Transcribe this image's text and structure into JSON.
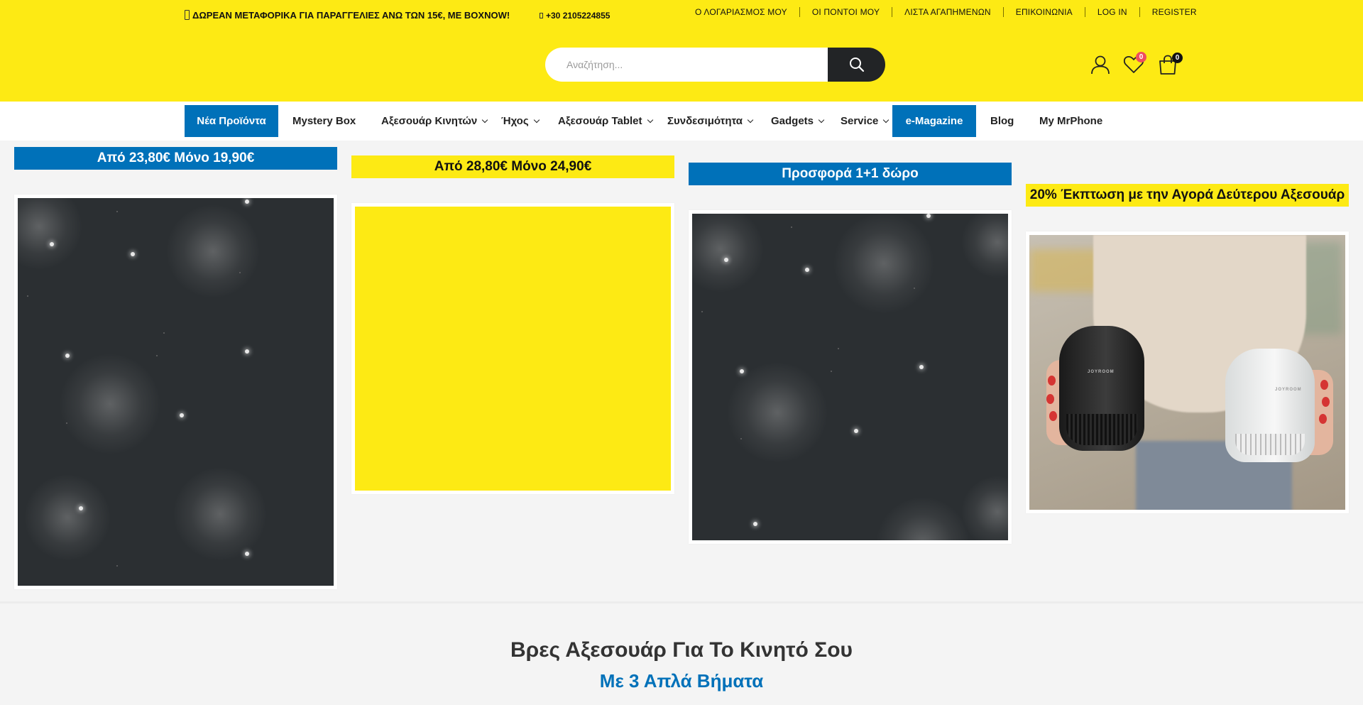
{
  "header": {
    "promo_text": "ΔΩΡΕΑΝ ΜΕΤΑΦΟΡΙΚΑ ΓΙΑ ΠΑΡΑΓΓΕΛΙΕΣ ΑΝΩ ΤΩΝ 15€, ΜΕ BOXNOW!",
    "phone": "+30 2105224855",
    "top_links": [
      "Ο ΛΟΓΑΡΙΑΣΜΟΣ ΜΟΥ",
      "ΟΙ ΠΟΝΤΟΙ ΜΟΥ",
      "ΛΙΣΤΑ ΑΓΑΠΗΜΕΝΩΝ",
      "ΕΠΙΚΟΙΝΩΝΙΑ",
      "LOG IN",
      "REGISTER"
    ],
    "search_placeholder": "Αναζήτηση...",
    "wishlist_count": "0",
    "cart_count": "0"
  },
  "nav": {
    "items": [
      "Νέα Προϊόντα",
      "Mystery Box",
      "Αξεσουάρ Κινητών",
      "Ήχος",
      "Αξεσουάρ Tablet",
      "Συνδεσιμότητα",
      "Gadgets",
      "Service",
      "e-Magazine",
      "Blog",
      "My MrPhone"
    ]
  },
  "promos": [
    {
      "label": "Από 23,80€ Μόνο 19,90€",
      "label_color": "#0071b9"
    },
    {
      "label": "Από 28,80€ Μόνο 24,90€",
      "label_color": "#fdea14"
    },
    {
      "label": "Προσφορά 1+1 δώρο",
      "label_color": "#0071b9"
    },
    {
      "label": "20% Έκπτωση με την Αγορά Δεύτερου Αξεσουάρ",
      "label_color": "#fdea14"
    }
  ],
  "steps": {
    "title": "Βρες Αξεσουάρ Για Το Κινητό Σου",
    "subtitle": "Με 3 Απλά Βήματα"
  },
  "product_brand": "JOYROOM",
  "colors": {
    "brand_yellow": "#fdea14",
    "brand_blue": "#0071b9",
    "dark": "#222426",
    "badge_red": "#ee4d5f"
  }
}
